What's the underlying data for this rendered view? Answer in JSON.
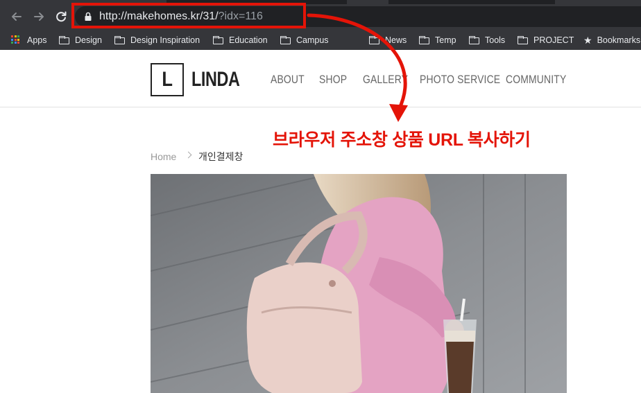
{
  "browser": {
    "url_main": "http://makehomes.kr/31/",
    "url_query": "?idx=116",
    "bookmarks": [
      {
        "label": "Apps",
        "icon": "apps-grid-icon"
      },
      {
        "label": "Design",
        "icon": "folder-icon"
      },
      {
        "label": "Design Inspiration",
        "icon": "folder-icon"
      },
      {
        "label": "Education",
        "icon": "folder-icon"
      },
      {
        "label": "Campus",
        "icon": "folder-icon"
      },
      {
        "label": "News",
        "icon": "folder-icon"
      },
      {
        "label": "Temp",
        "icon": "folder-icon"
      },
      {
        "label": "Tools",
        "icon": "folder-icon"
      },
      {
        "label": "PROJECT",
        "icon": "folder-icon"
      },
      {
        "label": "Bookmarks",
        "icon": "star-icon"
      }
    ]
  },
  "site": {
    "logo_letter": "L",
    "logo_text": "LINDA",
    "menu": [
      "ABOUT",
      "SHOP",
      "GALLERY",
      "PHOTO SERVICE",
      "COMMUNITY"
    ]
  },
  "breadcrumb": {
    "home": "Home",
    "current": "개인결제창"
  },
  "annotation": {
    "text": "브라우저 주소창 상품 URL 복사하기",
    "color": "#e41408"
  },
  "colors": {
    "chrome_bg": "#35363a",
    "highlight": "#e41408"
  }
}
